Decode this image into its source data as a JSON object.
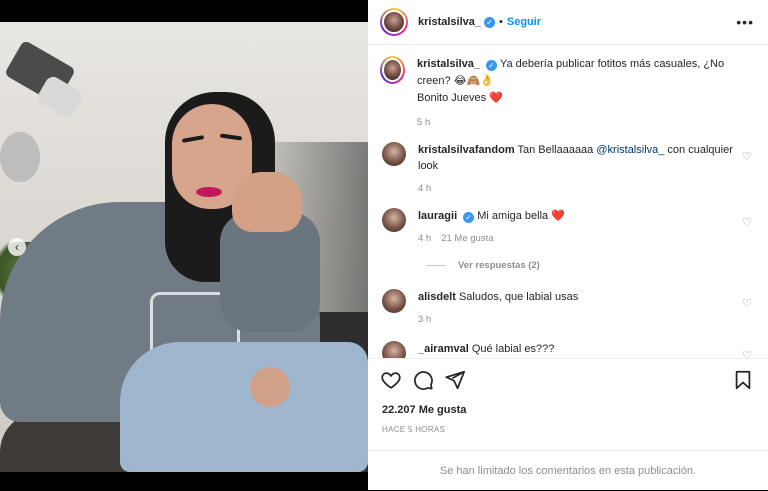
{
  "post": {
    "author": "kristalsilva_",
    "follow_label": "Seguir",
    "dot": "•",
    "more_icon": "more-horizontal-icon",
    "nav_prev": "‹"
  },
  "caption": {
    "author": "kristalsilva_",
    "text": "Ya debería publicar fotitos más casuales, ¿No creen? 😂🙈👌",
    "line2": "Bonito Jueves ❤️",
    "time": "5 h"
  },
  "comments": [
    {
      "user": "kristalsilvafandom",
      "text": "Tan Bellaaaaaa",
      "mention": "@kristalsilva_",
      "text_after": " con cualquier look",
      "time": "4 h"
    },
    {
      "user": "lauragii",
      "verified": true,
      "text": "Mi amiga bella ❤️",
      "time": "4 h",
      "likes": "21 Me gusta",
      "replies": "Ver respuestas (2)"
    },
    {
      "user": "alisdelt",
      "text": "Saludos, que labial usas",
      "time": "3 h"
    },
    {
      "user": "_airamval",
      "text": "Qué labial es???",
      "time": ""
    }
  ],
  "stats": {
    "likes": "22.207 Me gusta",
    "posted": "HACE 5 HORAS"
  },
  "footer": {
    "notice": "Se han limitado los comentarios en esta publicación."
  },
  "colors": {
    "follow": "#0095f6",
    "verified": "#3897f0",
    "heart_red": "#ed4956"
  }
}
